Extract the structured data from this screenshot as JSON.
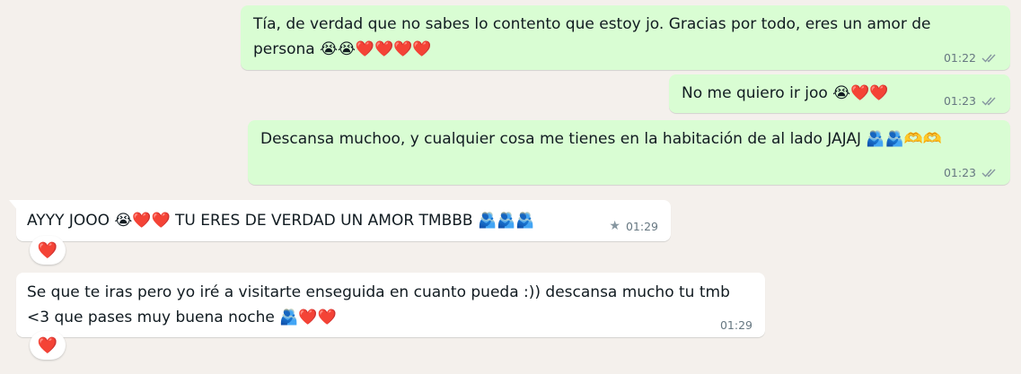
{
  "messages": [
    {
      "id": "m1",
      "direction": "outgoing",
      "text": "Tía, de verdad que no sabes lo contento que estoy jo. Gracias por todo, eres un amor de persona 😭😭❤️❤️❤️❤️",
      "time": "01:22",
      "status": "read-ticks"
    },
    {
      "id": "m2",
      "direction": "outgoing",
      "text": "No me quiero ir joo 😭❤️❤️",
      "time": "01:23",
      "status": "read-ticks"
    },
    {
      "id": "m3",
      "direction": "outgoing",
      "text": "Descansa muchoo, y cualquier cosa me tienes en la habitación de al lado JAJAJ 🫂🫂🫶🫶",
      "time": "01:23",
      "status": "read-ticks"
    },
    {
      "id": "m4",
      "direction": "incoming",
      "text": "AYYY JOOO 😭❤️❤️ TU ERES DE VERDAD UN AMOR TMBBB 🫂🫂🫂",
      "time": "01:29",
      "starred": true,
      "reaction": "❤️"
    },
    {
      "id": "m5",
      "direction": "incoming",
      "text": "Se que te iras pero yo iré a visitarte enseguida en cuanto pueda :)) descansa mucho tu tmb <3 que pases muy buena noche 🫂❤️❤️",
      "time": "01:29",
      "reaction": "❤️"
    }
  ],
  "icons": {
    "read_ticks": "double-check-icon",
    "star": "star-icon"
  },
  "colors": {
    "background": "#f4f0ec",
    "outgoing_bubble": "#d9fdd3",
    "incoming_bubble": "#ffffff",
    "meta_text": "#667781"
  }
}
